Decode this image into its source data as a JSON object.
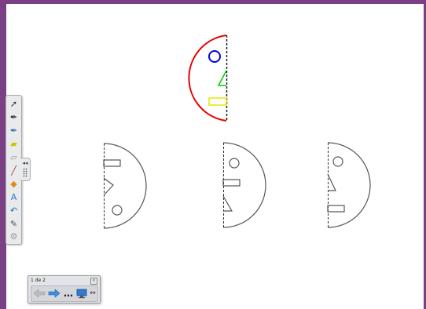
{
  "page_nav": {
    "page_count": "1 de 2",
    "close_glyph": "×",
    "prev_icon": "back-arrow-icon",
    "next_icon": "forward-arrow-icon",
    "more_glyph": "…",
    "monitor_icon": "screen-icon",
    "resize_glyph": "↔"
  },
  "toolbar": {
    "handle_arrows": "◂◂",
    "tools": [
      {
        "name": "select-arrow-icon",
        "glyph": "➚",
        "color": "#333333"
      },
      {
        "name": "pen-icon",
        "glyph": "✒",
        "color": "#333333"
      },
      {
        "name": "creative-pen-icon",
        "glyph": "✒",
        "color": "#3a6fb0"
      },
      {
        "name": "highlighter-icon",
        "glyph": "▰",
        "color": "#c8c800"
      },
      {
        "name": "eraser-icon",
        "glyph": "▱",
        "color": "#999999"
      },
      {
        "name": "line-icon",
        "glyph": "╱",
        "color": "#c03030"
      },
      {
        "name": "shapes-icon",
        "glyph": "◆",
        "color": "#e08a20"
      },
      {
        "name": "text-icon",
        "glyph": "A",
        "color": "#2c78c8"
      },
      {
        "name": "undo-icon",
        "glyph": "↶",
        "color": "#2a6ab8"
      },
      {
        "name": "fill-icon",
        "glyph": "✎",
        "color": "#555555"
      },
      {
        "name": "properties-icon",
        "glyph": "⚙",
        "color": "#999999"
      }
    ]
  },
  "colors": {
    "frame": "#7b3f86",
    "red_arc": "#e60000",
    "blue_circle": "#0000e6",
    "green_triangle": "#00cc00",
    "yellow_rect": "#e6e600",
    "outline_gray": "#555555"
  }
}
